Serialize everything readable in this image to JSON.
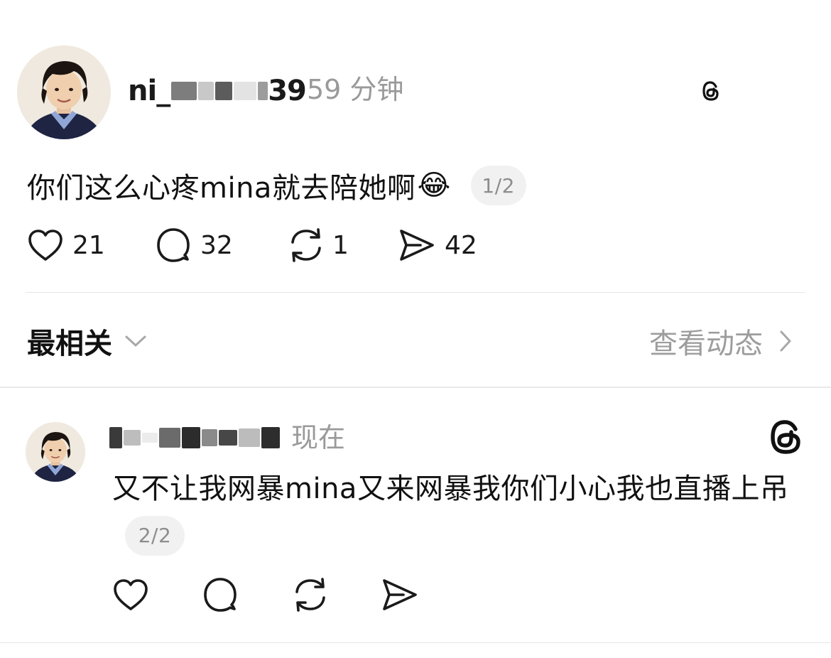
{
  "post": {
    "author": {
      "username_prefix": "ni_",
      "username_suffix": "39",
      "time": "59 分钟"
    },
    "brand": {
      "name": "threads"
    },
    "text": "你们这么心疼mina就去陪她啊",
    "emoji": "😂",
    "page": "1/2",
    "stats": {
      "likes": "21",
      "comments": "32",
      "reposts": "1",
      "shares": "42"
    }
  },
  "filter_bar": {
    "sort_label": "最相关",
    "activity_label": "查看动态"
  },
  "reply": {
    "author": {
      "time": "现在"
    },
    "text": "又不让我网暴mina又来网暴我你们小心我也直播上吊",
    "page": "2/2"
  },
  "icons": {
    "like": "heart-icon",
    "comment": "comment-icon",
    "repost": "repost-icon",
    "share": "send-icon",
    "brand": "threads-logo-icon",
    "chevron_down": "chevron-down-icon",
    "chevron_right": "chevron-right-icon"
  },
  "colors": {
    "text": "#111111",
    "muted": "#9a9a9a",
    "pill_bg": "#f1f1f1",
    "divider": "#e6e6e6"
  }
}
